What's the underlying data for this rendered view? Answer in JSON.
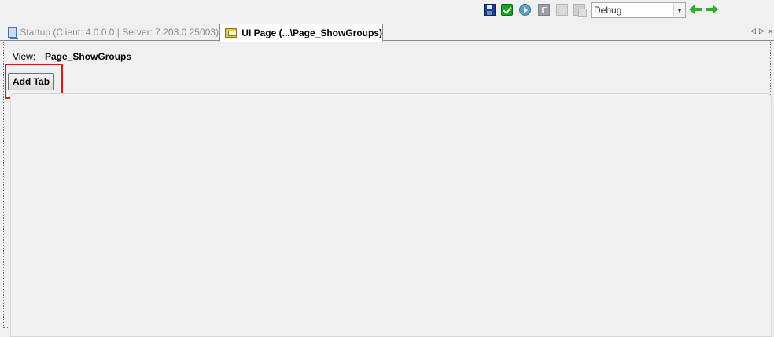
{
  "toolbar": {
    "icons": [
      "save-icon",
      "validate-check-icon",
      "run-icon",
      "visual-studio-icon",
      "document-icon",
      "copy-documents-icon"
    ],
    "configuration": {
      "selected": "Debug"
    },
    "colors": {
      "arrow": "#2fae2f",
      "check": "#1aa12a"
    }
  },
  "tabs": [
    {
      "label": "Startup (Client: 4.0.0.0 | Server: 7.203.0.25003)",
      "active": false
    },
    {
      "label": "UI Page (...\\Page_ShowGroups)",
      "active": true
    }
  ],
  "tab_nav": {
    "left": "◁",
    "right": "▷",
    "close": "×"
  },
  "view": {
    "label": "View:",
    "value": "Page_ShowGroups"
  },
  "actions": {
    "add_tab_label": "Add Tab"
  },
  "colors": {
    "highlight": "#e0141e",
    "background": "#f0f0f0"
  }
}
